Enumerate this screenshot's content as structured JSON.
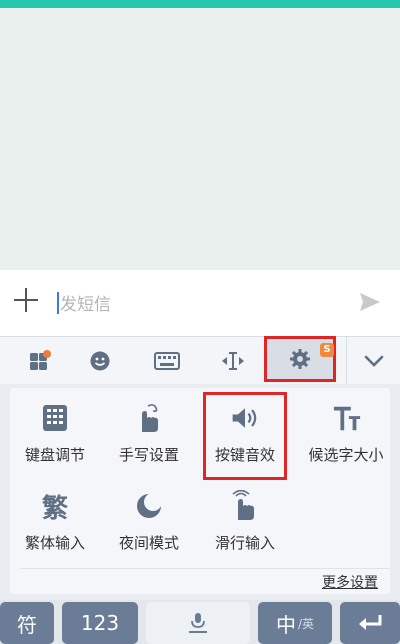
{
  "compose": {
    "placeholder": "发短信"
  },
  "toolbar": {
    "logo_badge": "S",
    "icons": [
      "apps-icon",
      "emoji-icon",
      "keyboard-icon",
      "cursor-move-icon",
      "gear-icon",
      "chevron-down-icon"
    ]
  },
  "panel": {
    "items": [
      {
        "label": "键盘调节",
        "icon": "keyboard-adjust-icon"
      },
      {
        "label": "手写设置",
        "icon": "handwriting-icon"
      },
      {
        "label": "按键音效",
        "icon": "speaker-icon"
      },
      {
        "label": "候选字大小",
        "icon": "text-size-icon"
      },
      {
        "label": "繁体输入",
        "icon": "traditional-chinese-icon",
        "glyph": "繁"
      },
      {
        "label": "夜间模式",
        "icon": "moon-icon"
      },
      {
        "label": "滑行输入",
        "icon": "swipe-icon"
      }
    ],
    "more": "更多设置"
  },
  "keyboard": {
    "key1": "符",
    "key2": "123",
    "key4_main": "中",
    "key4_sub": "/英"
  },
  "colors": {
    "top_bar": "#26c6ad",
    "highlight": "#e02525",
    "key_dark": "#6b7d96"
  }
}
